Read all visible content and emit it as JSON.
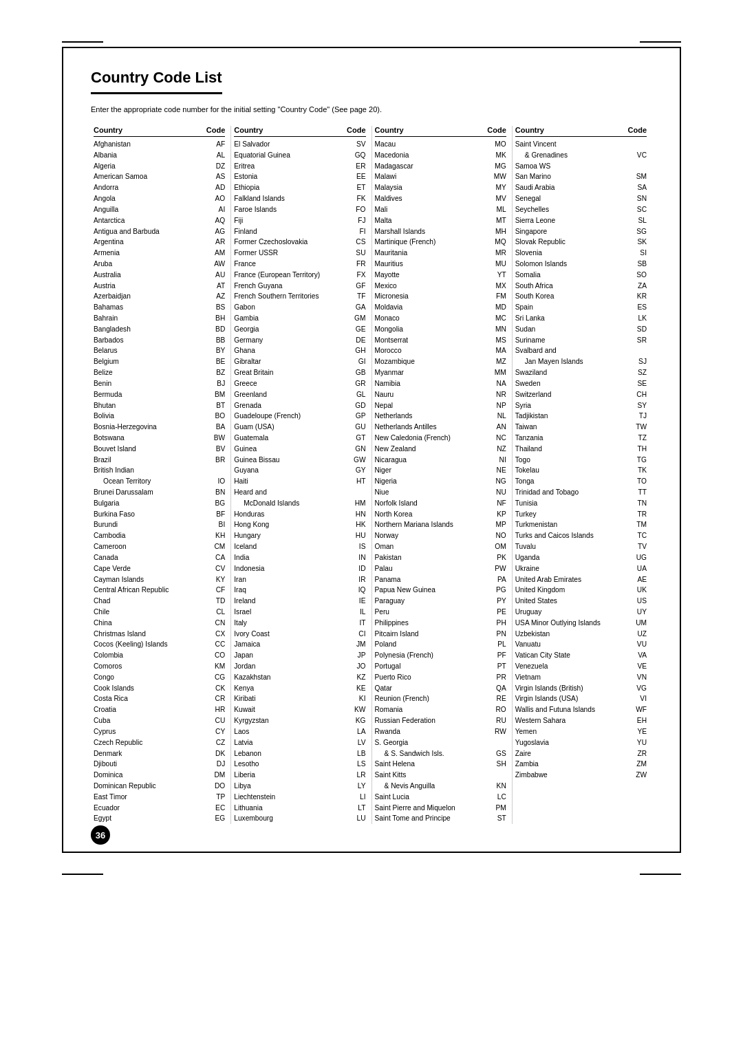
{
  "page": {
    "title": "Country Code List",
    "subtitle": "Enter the appropriate code number for the initial setting \"Country Code\" (See page 20).",
    "page_number": "36"
  },
  "columns": [
    {
      "header": {
        "country": "Country",
        "code": "Code"
      },
      "rows": [
        {
          "name": "Afghanistan",
          "code": "AF"
        },
        {
          "name": "Albania",
          "code": "AL"
        },
        {
          "name": "Algeria",
          "code": "DZ"
        },
        {
          "name": "American Samoa",
          "code": "AS"
        },
        {
          "name": "Andorra",
          "code": "AD"
        },
        {
          "name": "Angola",
          "code": "AO"
        },
        {
          "name": "Anguilla",
          "code": "AI"
        },
        {
          "name": "Antarctica",
          "code": "AQ"
        },
        {
          "name": "Antigua and Barbuda",
          "code": "AG"
        },
        {
          "name": "Argentina",
          "code": "AR"
        },
        {
          "name": "Armenia",
          "code": "AM"
        },
        {
          "name": "Aruba",
          "code": "AW"
        },
        {
          "name": "Australia",
          "code": "AU"
        },
        {
          "name": "Austria",
          "code": "AT"
        },
        {
          "name": "Azerbaidjan",
          "code": "AZ"
        },
        {
          "name": "Bahamas",
          "code": "BS"
        },
        {
          "name": "Bahrain",
          "code": "BH"
        },
        {
          "name": "Bangladesh",
          "code": "BD"
        },
        {
          "name": "Barbados",
          "code": "BB"
        },
        {
          "name": "Belarus",
          "code": "BY"
        },
        {
          "name": "Belgium",
          "code": "BE"
        },
        {
          "name": "Belize",
          "code": "BZ"
        },
        {
          "name": "Benin",
          "code": "BJ"
        },
        {
          "name": "Bermuda",
          "code": "BM"
        },
        {
          "name": "Bhutan",
          "code": "BT"
        },
        {
          "name": "Bolivia",
          "code": "BO"
        },
        {
          "name": "Bosnia-Herzegovina",
          "code": "BA"
        },
        {
          "name": "Botswana",
          "code": "BW"
        },
        {
          "name": "Bouvet Island",
          "code": "BV"
        },
        {
          "name": "Brazil",
          "code": "BR"
        },
        {
          "name": "British Indian",
          "code": ""
        },
        {
          "name": "   Ocean Territory",
          "code": "IO",
          "indent": true
        },
        {
          "name": "Brunei Darussalam",
          "code": "BN"
        },
        {
          "name": "Bulgaria",
          "code": "BG"
        },
        {
          "name": "Burkina Faso",
          "code": "BF"
        },
        {
          "name": "Burundi",
          "code": "BI"
        },
        {
          "name": "Cambodia",
          "code": "KH"
        },
        {
          "name": "Cameroon",
          "code": "CM"
        },
        {
          "name": "Canada",
          "code": "CA"
        },
        {
          "name": "Cape Verde",
          "code": "CV"
        },
        {
          "name": "Cayman Islands",
          "code": "KY"
        },
        {
          "name": "Central African Republic",
          "code": "CF"
        },
        {
          "name": "Chad",
          "code": "TD"
        },
        {
          "name": "Chile",
          "code": "CL"
        },
        {
          "name": "China",
          "code": "CN"
        },
        {
          "name": "Christmas Island",
          "code": "CX"
        },
        {
          "name": "Cocos (Keeling) Islands",
          "code": "CC"
        },
        {
          "name": "Colombia",
          "code": "CO"
        },
        {
          "name": "Comoros",
          "code": "KM"
        },
        {
          "name": "Congo",
          "code": "CG"
        },
        {
          "name": "Cook Islands",
          "code": "CK"
        },
        {
          "name": "Costa Rica",
          "code": "CR"
        },
        {
          "name": "Croatia",
          "code": "HR"
        },
        {
          "name": "Cuba",
          "code": "CU"
        },
        {
          "name": "Cyprus",
          "code": "CY"
        },
        {
          "name": "Czech Republic",
          "code": "CZ"
        },
        {
          "name": "Denmark",
          "code": "DK"
        },
        {
          "name": "Djibouti",
          "code": "DJ"
        },
        {
          "name": "Dominica",
          "code": "DM"
        },
        {
          "name": "Dominican Republic",
          "code": "DO"
        },
        {
          "name": "East Timor",
          "code": "TP"
        },
        {
          "name": "Ecuador",
          "code": "EC"
        },
        {
          "name": "Egypt",
          "code": "EG"
        }
      ]
    },
    {
      "header": {
        "country": "Country",
        "code": "Code"
      },
      "rows": [
        {
          "name": "El Salvador",
          "code": "SV"
        },
        {
          "name": "Equatorial Guinea",
          "code": "GQ"
        },
        {
          "name": "Eritrea",
          "code": "ER"
        },
        {
          "name": "Estonia",
          "code": "EE"
        },
        {
          "name": "Ethiopia",
          "code": "ET"
        },
        {
          "name": "Falkland Islands",
          "code": "FK"
        },
        {
          "name": "Faroe Islands",
          "code": "FO"
        },
        {
          "name": "Fiji",
          "code": "FJ"
        },
        {
          "name": "Finland",
          "code": "FI"
        },
        {
          "name": "Former Czechoslovakia",
          "code": "CS"
        },
        {
          "name": "Former USSR",
          "code": "SU"
        },
        {
          "name": "France",
          "code": "FR"
        },
        {
          "name": "France (European Territory)",
          "code": "FX"
        },
        {
          "name": "French Guyana",
          "code": "GF"
        },
        {
          "name": "French Southern Territories",
          "code": "TF"
        },
        {
          "name": "Gabon",
          "code": "GA"
        },
        {
          "name": "Gambia",
          "code": "GM"
        },
        {
          "name": "Georgia",
          "code": "GE"
        },
        {
          "name": "Germany",
          "code": "DE"
        },
        {
          "name": "Ghana",
          "code": "GH"
        },
        {
          "name": "Gibraltar",
          "code": "GI"
        },
        {
          "name": "Great Britain",
          "code": "GB"
        },
        {
          "name": "Greece",
          "code": "GR"
        },
        {
          "name": "Greenland",
          "code": "GL"
        },
        {
          "name": "Grenada",
          "code": "GD"
        },
        {
          "name": "Guadeloupe (French)",
          "code": "GP"
        },
        {
          "name": "Guam (USA)",
          "code": "GU"
        },
        {
          "name": "Guatemala",
          "code": "GT"
        },
        {
          "name": "Guinea",
          "code": "GN"
        },
        {
          "name": "Guinea Bissau",
          "code": "GW"
        },
        {
          "name": "Guyana",
          "code": "GY"
        },
        {
          "name": "Haiti",
          "code": "HT"
        },
        {
          "name": "Heard and",
          "code": ""
        },
        {
          "name": "   McDonald Islands",
          "code": "HM",
          "indent": true
        },
        {
          "name": "Honduras",
          "code": "HN"
        },
        {
          "name": "Hong Kong",
          "code": "HK"
        },
        {
          "name": "Hungary",
          "code": "HU"
        },
        {
          "name": "Iceland",
          "code": "IS"
        },
        {
          "name": "India",
          "code": "IN"
        },
        {
          "name": "Indonesia",
          "code": "ID"
        },
        {
          "name": "Iran",
          "code": "IR"
        },
        {
          "name": "Iraq",
          "code": "IQ"
        },
        {
          "name": "Ireland",
          "code": "IE"
        },
        {
          "name": "Israel",
          "code": "IL"
        },
        {
          "name": "Italy",
          "code": "IT"
        },
        {
          "name": "Ivory Coast",
          "code": "CI"
        },
        {
          "name": "Jamaica",
          "code": "JM"
        },
        {
          "name": "Japan",
          "code": "JP"
        },
        {
          "name": "Jordan",
          "code": "JO"
        },
        {
          "name": "Kazakhstan",
          "code": "KZ"
        },
        {
          "name": "Kenya",
          "code": "KE"
        },
        {
          "name": "Kiribati",
          "code": "KI"
        },
        {
          "name": "Kuwait",
          "code": "KW"
        },
        {
          "name": "Kyrgyzstan",
          "code": "KG"
        },
        {
          "name": "Laos",
          "code": "LA"
        },
        {
          "name": "Latvia",
          "code": "LV"
        },
        {
          "name": "Lebanon",
          "code": "LB"
        },
        {
          "name": "Lesotho",
          "code": "LS"
        },
        {
          "name": "Liberia",
          "code": "LR"
        },
        {
          "name": "Libya",
          "code": "LY"
        },
        {
          "name": "Liechtenstein",
          "code": "LI"
        },
        {
          "name": "Lithuania",
          "code": "LT"
        },
        {
          "name": "Luxembourg",
          "code": "LU"
        }
      ]
    },
    {
      "header": {
        "country": "Country",
        "code": "Code"
      },
      "rows": [
        {
          "name": "Macau",
          "code": "MO"
        },
        {
          "name": "Macedonia",
          "code": "MK"
        },
        {
          "name": "Madagascar",
          "code": "MG"
        },
        {
          "name": "Malawi",
          "code": "MW"
        },
        {
          "name": "Malaysia",
          "code": "MY"
        },
        {
          "name": "Maldives",
          "code": "MV"
        },
        {
          "name": "Mali",
          "code": "ML"
        },
        {
          "name": "Malta",
          "code": "MT"
        },
        {
          "name": "Marshall Islands",
          "code": "MH"
        },
        {
          "name": "Martinique (French)",
          "code": "MQ"
        },
        {
          "name": "Mauritania",
          "code": "MR"
        },
        {
          "name": "Mauritius",
          "code": "MU"
        },
        {
          "name": "Mayotte",
          "code": "YT"
        },
        {
          "name": "Mexico",
          "code": "MX"
        },
        {
          "name": "Micronesia",
          "code": "FM"
        },
        {
          "name": "Moldavia",
          "code": "MD"
        },
        {
          "name": "Monaco",
          "code": "MC"
        },
        {
          "name": "Mongolia",
          "code": "MN"
        },
        {
          "name": "Montserrat",
          "code": "MS"
        },
        {
          "name": "Morocco",
          "code": "MA"
        },
        {
          "name": "Mozambique",
          "code": "MZ"
        },
        {
          "name": "Myanmar",
          "code": "MM"
        },
        {
          "name": "Namibia",
          "code": "NA"
        },
        {
          "name": "Nauru",
          "code": "NR"
        },
        {
          "name": "Nepal",
          "code": "NP"
        },
        {
          "name": "Netherlands",
          "code": "NL"
        },
        {
          "name": "Netherlands Antilles",
          "code": "AN"
        },
        {
          "name": "New Caledonia (French)",
          "code": "NC"
        },
        {
          "name": "New Zealand",
          "code": "NZ"
        },
        {
          "name": "Nicaragua",
          "code": "NI"
        },
        {
          "name": "Niger",
          "code": "NE"
        },
        {
          "name": "Nigeria",
          "code": "NG"
        },
        {
          "name": "Niue",
          "code": "NU"
        },
        {
          "name": "Norfolk Island",
          "code": "NF"
        },
        {
          "name": "North Korea",
          "code": "KP"
        },
        {
          "name": "Northern Mariana Islands",
          "code": "MP"
        },
        {
          "name": "Norway",
          "code": "NO"
        },
        {
          "name": "Oman",
          "code": "OM"
        },
        {
          "name": "Pakistan",
          "code": "PK"
        },
        {
          "name": "Palau",
          "code": "PW"
        },
        {
          "name": "Panama",
          "code": "PA"
        },
        {
          "name": "Papua New Guinea",
          "code": "PG"
        },
        {
          "name": "Paraguay",
          "code": "PY"
        },
        {
          "name": "Peru",
          "code": "PE"
        },
        {
          "name": "Philippines",
          "code": "PH"
        },
        {
          "name": "Pitcairn Island",
          "code": "PN"
        },
        {
          "name": "Poland",
          "code": "PL"
        },
        {
          "name": "Polynesia (French)",
          "code": "PF"
        },
        {
          "name": "Portugal",
          "code": "PT"
        },
        {
          "name": "Puerto Rico",
          "code": "PR"
        },
        {
          "name": "Qatar",
          "code": "QA"
        },
        {
          "name": "Reunion (French)",
          "code": "RE"
        },
        {
          "name": "Romania",
          "code": "RO"
        },
        {
          "name": "Russian Federation",
          "code": "RU"
        },
        {
          "name": "Rwanda",
          "code": "RW"
        },
        {
          "name": "S. Georgia",
          "code": ""
        },
        {
          "name": "   & S. Sandwich Isls.",
          "code": "GS",
          "indent": true
        },
        {
          "name": "Saint Helena",
          "code": "SH"
        },
        {
          "name": "Saint Kitts",
          "code": ""
        },
        {
          "name": "   & Nevis Anguilla",
          "code": "KN",
          "indent": true
        },
        {
          "name": "Saint Lucia",
          "code": "LC"
        },
        {
          "name": "Saint Pierre and Miquelon",
          "code": "PM"
        },
        {
          "name": "Saint Tome and Principe",
          "code": "ST"
        }
      ]
    },
    {
      "header": {
        "country": "Country",
        "code": "Code"
      },
      "rows": [
        {
          "name": "Saint Vincent",
          "code": ""
        },
        {
          "name": "   & Grenadines",
          "code": "VC",
          "indent": true
        },
        {
          "name": "Samoa WS",
          "code": ""
        },
        {
          "name": "San Marino",
          "code": "SM"
        },
        {
          "name": "Saudi Arabia",
          "code": "SA"
        },
        {
          "name": "Senegal",
          "code": "SN"
        },
        {
          "name": "Seychelles",
          "code": "SC"
        },
        {
          "name": "Sierra Leone",
          "code": "SL"
        },
        {
          "name": "Singapore",
          "code": "SG"
        },
        {
          "name": "Slovak Republic",
          "code": "SK"
        },
        {
          "name": "Slovenia",
          "code": "SI"
        },
        {
          "name": "Solomon Islands",
          "code": "SB"
        },
        {
          "name": "Somalia",
          "code": "SO"
        },
        {
          "name": "South Africa",
          "code": "ZA"
        },
        {
          "name": "South Korea",
          "code": "KR"
        },
        {
          "name": "Spain",
          "code": "ES"
        },
        {
          "name": "Sri Lanka",
          "code": "LK"
        },
        {
          "name": "Sudan",
          "code": "SD"
        },
        {
          "name": "Suriname",
          "code": "SR"
        },
        {
          "name": "Svalbard and",
          "code": ""
        },
        {
          "name": "   Jan Mayen Islands",
          "code": "SJ",
          "indent": true
        },
        {
          "name": "Swaziland",
          "code": "SZ"
        },
        {
          "name": "Sweden",
          "code": "SE"
        },
        {
          "name": "Switzerland",
          "code": "CH"
        },
        {
          "name": "Syria",
          "code": "SY"
        },
        {
          "name": "Tadjikistan",
          "code": "TJ"
        },
        {
          "name": "Taiwan",
          "code": "TW"
        },
        {
          "name": "Tanzania",
          "code": "TZ"
        },
        {
          "name": "Thailand",
          "code": "TH"
        },
        {
          "name": "Togo",
          "code": "TG"
        },
        {
          "name": "Tokelau",
          "code": "TK"
        },
        {
          "name": "Tonga",
          "code": "TO"
        },
        {
          "name": "Trinidad and Tobago",
          "code": "TT"
        },
        {
          "name": "Tunisia",
          "code": "TN"
        },
        {
          "name": "Turkey",
          "code": "TR"
        },
        {
          "name": "Turkmenistan",
          "code": "TM"
        },
        {
          "name": "Turks and Caicos Islands",
          "code": "TC"
        },
        {
          "name": "Tuvalu",
          "code": "TV"
        },
        {
          "name": "Uganda",
          "code": "UG"
        },
        {
          "name": "Ukraine",
          "code": "UA"
        },
        {
          "name": "United Arab Emirates",
          "code": "AE"
        },
        {
          "name": "United Kingdom",
          "code": "UK"
        },
        {
          "name": "United States",
          "code": "US"
        },
        {
          "name": "Uruguay",
          "code": "UY"
        },
        {
          "name": "USA Minor Outlying Islands",
          "code": "UM"
        },
        {
          "name": "Uzbekistan",
          "code": "UZ"
        },
        {
          "name": "Vanuatu",
          "code": "VU"
        },
        {
          "name": "Vatican City State",
          "code": "VA"
        },
        {
          "name": "Venezuela",
          "code": "VE"
        },
        {
          "name": "Vietnam",
          "code": "VN"
        },
        {
          "name": "Virgin Islands (British)",
          "code": "VG"
        },
        {
          "name": "Virgin Islands (USA)",
          "code": "VI"
        },
        {
          "name": "Wallis and Futuna Islands",
          "code": "WF"
        },
        {
          "name": "Western Sahara",
          "code": "EH"
        },
        {
          "name": "Yemen",
          "code": "YE"
        },
        {
          "name": "Yugoslavia",
          "code": "YU"
        },
        {
          "name": "Zaire",
          "code": "ZR"
        },
        {
          "name": "Zambia",
          "code": "ZM"
        },
        {
          "name": "Zimbabwe",
          "code": "ZW"
        }
      ]
    }
  ]
}
